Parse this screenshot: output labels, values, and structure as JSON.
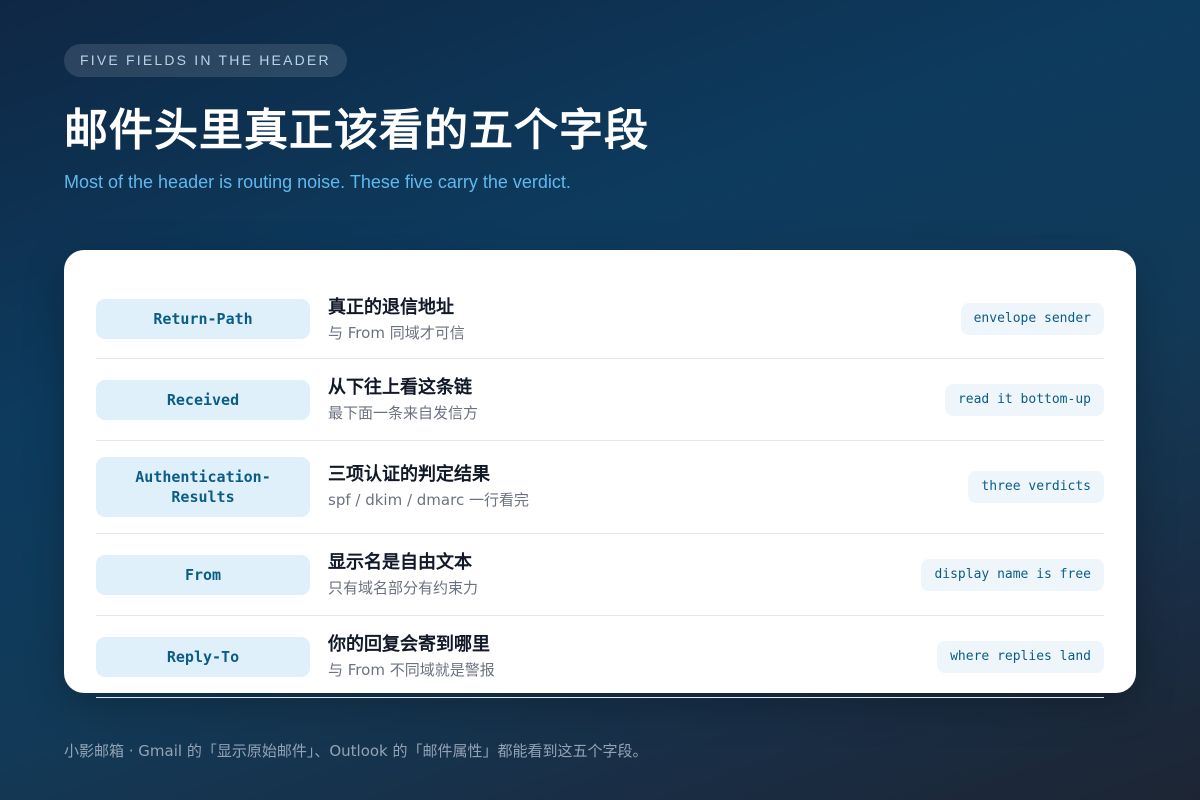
{
  "header": {
    "pill": "FIVE FIELDS IN THE HEADER",
    "title": "邮件头里真正该看的五个字段",
    "subtitle": "Most of the header is routing noise. These five carry the verdict."
  },
  "fields": [
    {
      "name": "Return-Path",
      "title": "真正的退信地址",
      "note": "与 From 同域才可信",
      "tag": "envelope sender"
    },
    {
      "name": "Received",
      "title": "从下往上看这条链",
      "note": "最下面一条来自发信方",
      "tag": "read it bottom-up"
    },
    {
      "name": "Authentication-Results",
      "title": "三项认证的判定结果",
      "note": "spf / dkim / dmarc 一行看完",
      "tag": "three verdicts"
    },
    {
      "name": "From",
      "title": "显示名是自由文本",
      "note": "只有域名部分有约束力",
      "tag": "display name is free"
    },
    {
      "name": "Reply-To",
      "title": "你的回复会寄到哪里",
      "note": "与 From 不同域就是警报",
      "tag": "where replies land"
    }
  ],
  "footer": "小影邮箱 · Gmail 的「显示原始邮件」、Outlook 的「邮件属性」都能看到这五个字段。",
  "colors": {
    "accent": "#0c5d86",
    "subtitle": "#5fb8ee",
    "field_bg": "#dff0fb"
  }
}
